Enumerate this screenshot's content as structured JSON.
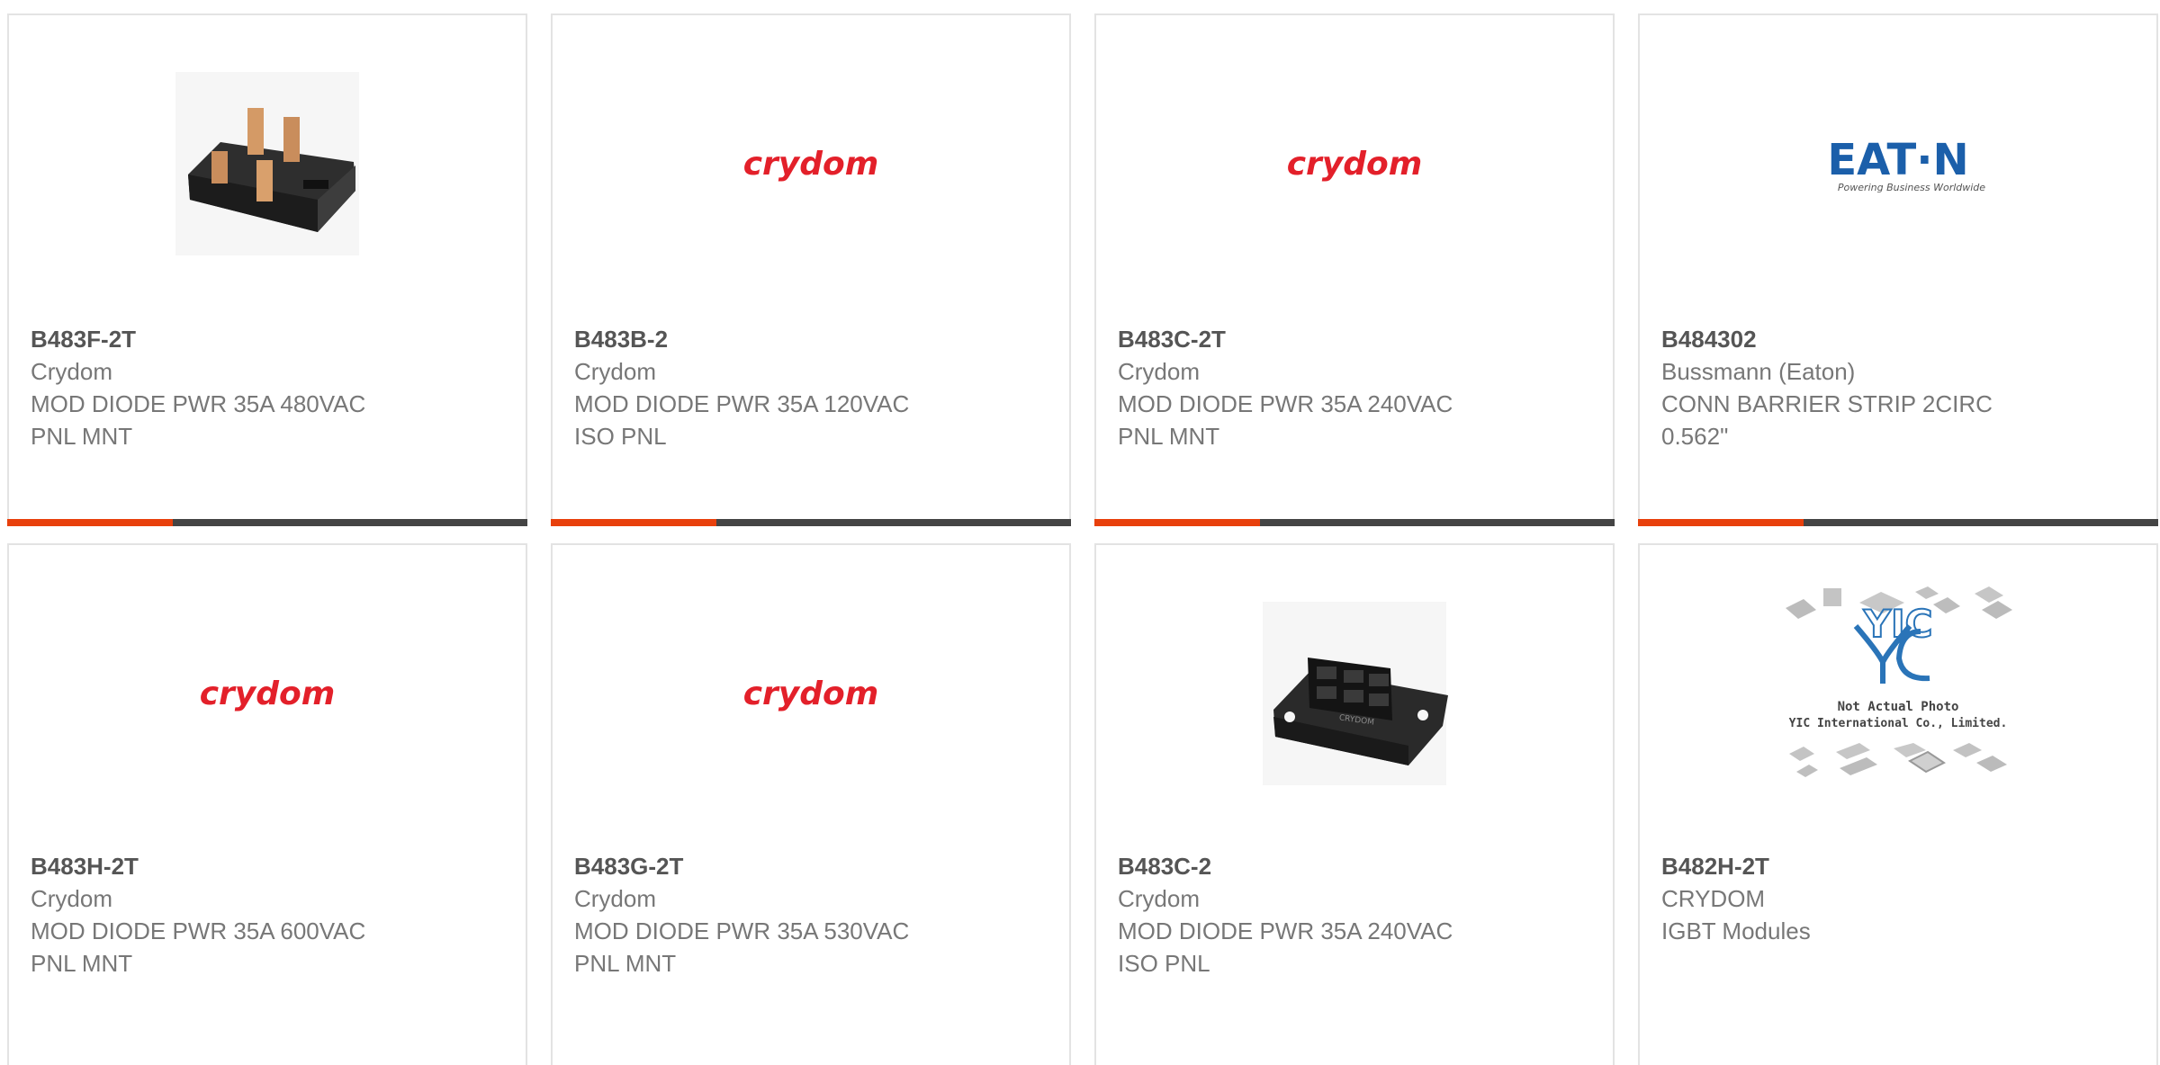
{
  "colors": {
    "accent": "#e8400c",
    "bar_dark": "#444444",
    "crydom_red": "#e3202a",
    "eaton_blue": "#1b5faa"
  },
  "products": [
    {
      "part": "B483F-2T",
      "manufacturer": "Crydom",
      "description": "MOD DIODE PWR 35A 480VAC PNL MNT",
      "image": "diode-module-photo"
    },
    {
      "part": "B483B-2",
      "manufacturer": "Crydom",
      "description": "MOD DIODE PWR 35A 120VAC ISO PNL",
      "image": "crydom-logo",
      "logo_text": "crydom"
    },
    {
      "part": "B483C-2T",
      "manufacturer": "Crydom",
      "description": "MOD DIODE PWR 35A 240VAC PNL MNT",
      "image": "crydom-logo",
      "logo_text": "crydom"
    },
    {
      "part": "B484302",
      "manufacturer": "Bussmann (Eaton)",
      "description": "CONN BARRIER STRIP 2CIRC 0.562\"",
      "image": "eaton-logo",
      "logo_text": "EAT·N",
      "logo_tagline": "Powering Business Worldwide"
    },
    {
      "part": "B483H-2T",
      "manufacturer": "Crydom",
      "description": "MOD DIODE PWR 35A 600VAC PNL MNT",
      "image": "crydom-logo",
      "logo_text": "crydom"
    },
    {
      "part": "B483G-2T",
      "manufacturer": "Crydom",
      "description": "MOD DIODE PWR 35A 530VAC PNL MNT",
      "image": "crydom-logo",
      "logo_text": "crydom"
    },
    {
      "part": "B483C-2",
      "manufacturer": "Crydom",
      "description": "MOD DIODE PWR 35A 240VAC ISO PNL",
      "image": "diode-module-iso-photo",
      "logo_text": "CRYDOM"
    },
    {
      "part": "B482H-2T",
      "manufacturer": "CRYDOM",
      "description": "IGBT Modules",
      "image": "yic-placeholder",
      "logo_text": "YIC",
      "placeholder_line1": "Not Actual Photo",
      "placeholder_line2": "YIC International Co., Limited."
    }
  ]
}
